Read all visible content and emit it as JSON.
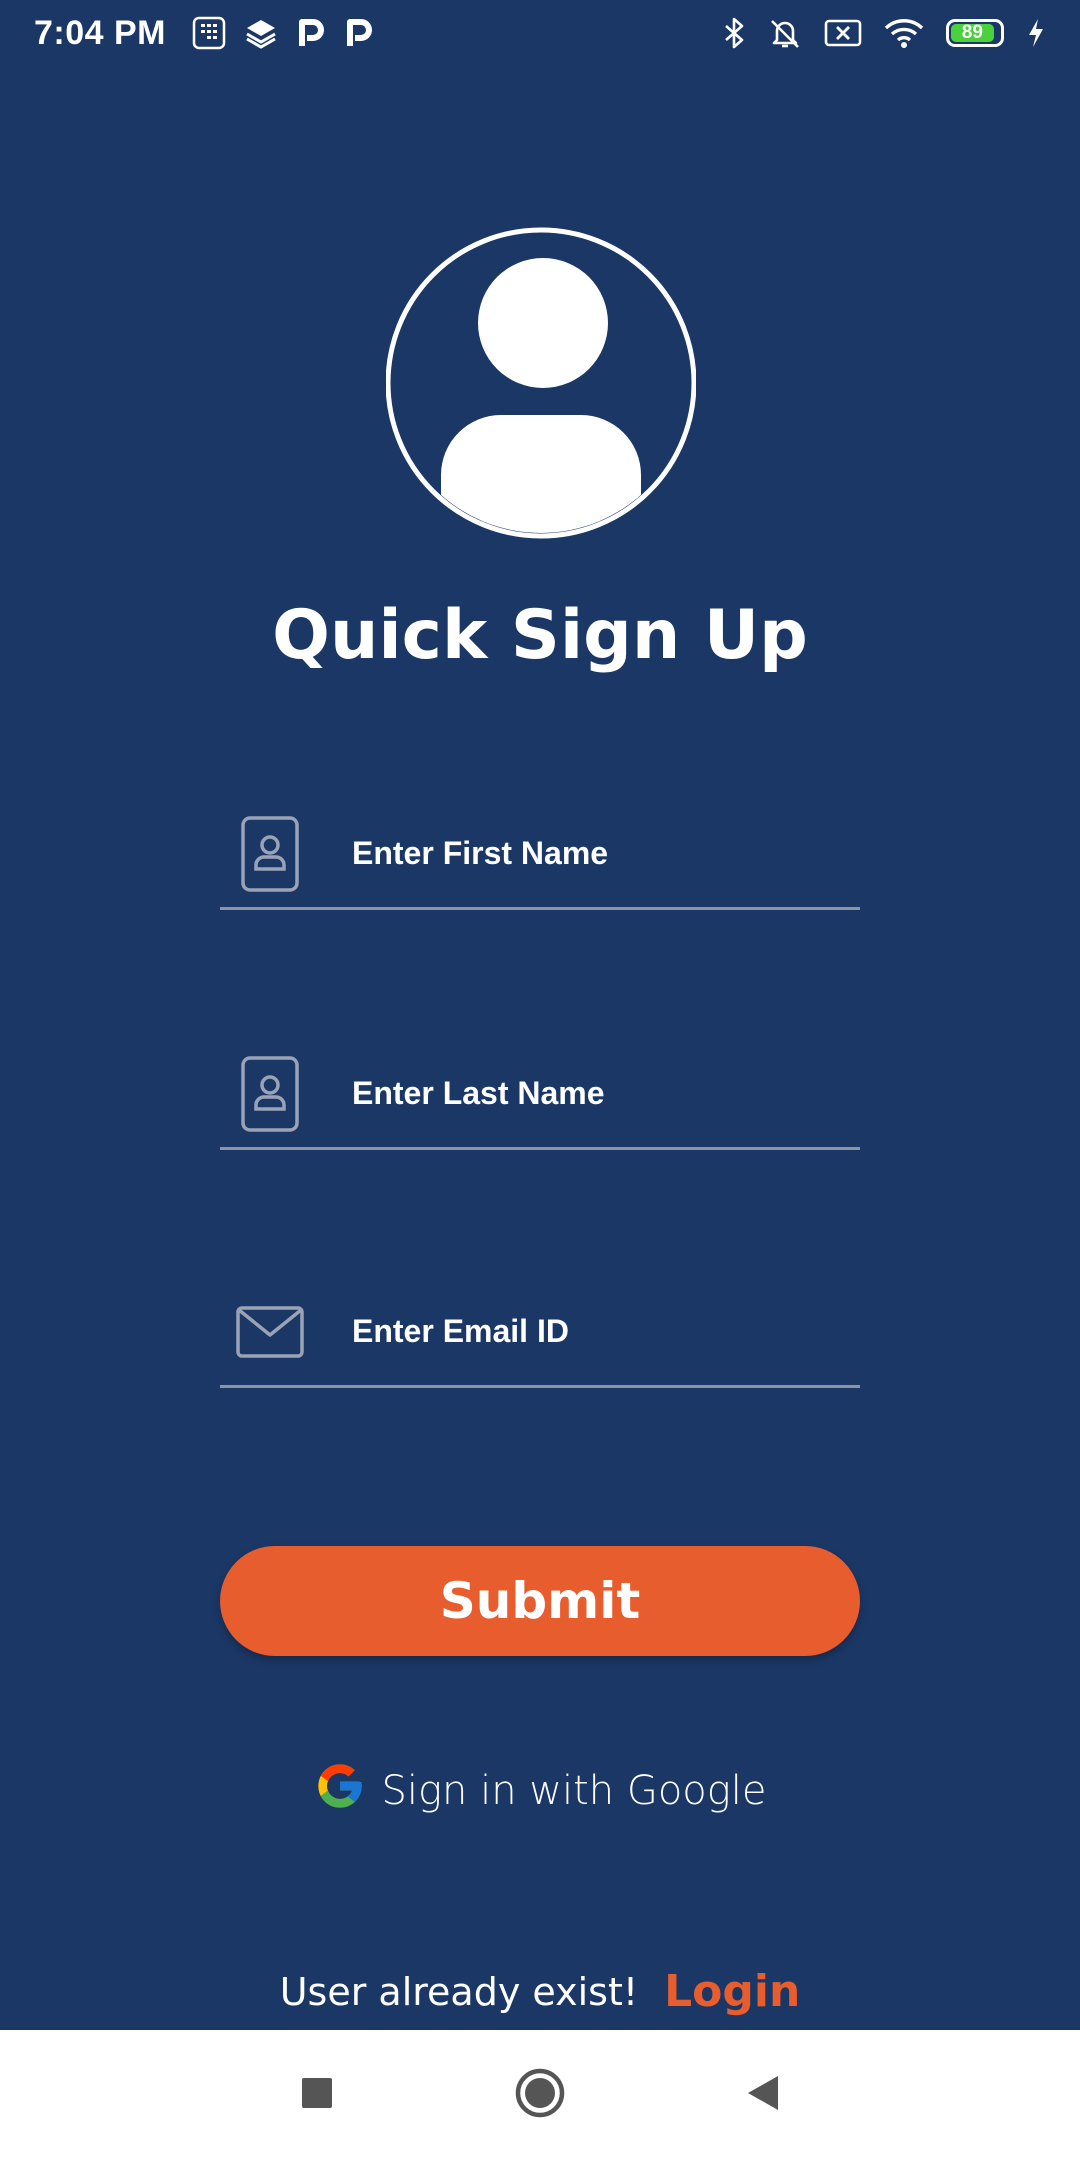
{
  "status_bar": {
    "time": "7:04 PM",
    "battery": "89"
  },
  "form": {
    "title": "Quick Sign Up",
    "first_name_placeholder": "Enter First Name",
    "last_name_placeholder": "Enter Last Name",
    "email_placeholder": "Enter Email ID",
    "submit_label": "Submit"
  },
  "google": {
    "label": "Sign in with Google"
  },
  "footer": {
    "existing_user_text": "User already exist!",
    "login_label": "Login"
  },
  "colors": {
    "background": "#1b3766",
    "accent": "#e85d2e"
  }
}
